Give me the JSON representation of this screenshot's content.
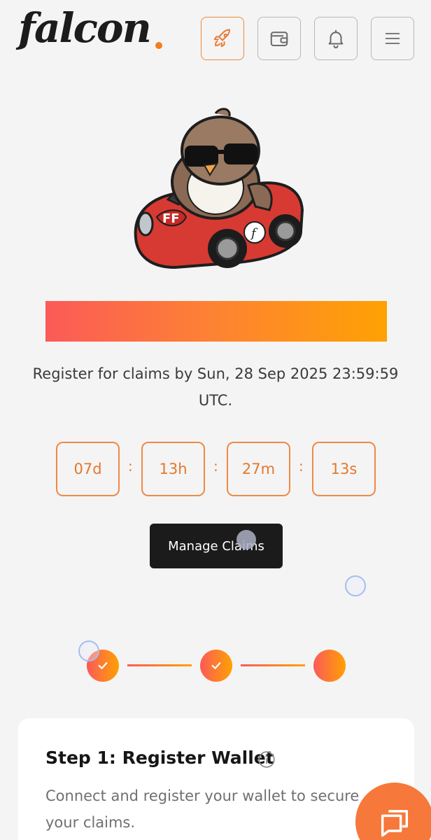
{
  "header": {
    "logo_text": "falcon",
    "accent_color": "#f57c1f",
    "buttons": [
      {
        "icon": "rocket-icon",
        "active": true
      },
      {
        "icon": "wallet-icon",
        "active": false
      },
      {
        "icon": "bell-icon",
        "active": false
      },
      {
        "icon": "menu-icon",
        "active": false
      }
    ]
  },
  "hero": {
    "mascot": "falcon-mascot-driving-red-car",
    "car_badge_text": "FF",
    "car_logo_text": "f",
    "gradient_colors": [
      "#fb5a58",
      "#fd8332",
      "#ffa103"
    ]
  },
  "register": {
    "text": "Register for claims by Sun, 28 Sep 2025 23:59:59 UTC."
  },
  "countdown": {
    "days": "07d",
    "hours": "13h",
    "minutes": "27m",
    "seconds": "13s",
    "separator": ":"
  },
  "manage_button": {
    "label": "Manage Claims"
  },
  "stepper": {
    "steps": [
      {
        "status": "done",
        "icon": "check-icon"
      },
      {
        "status": "done",
        "icon": "check-icon"
      },
      {
        "status": "current",
        "icon": ""
      }
    ]
  },
  "step_card": {
    "title": "Step 1: Register Wallet",
    "info_icon": "info-icon",
    "description": "Connect and register your wallet to secure your claims."
  },
  "chat": {
    "icon": "chat-icon"
  }
}
